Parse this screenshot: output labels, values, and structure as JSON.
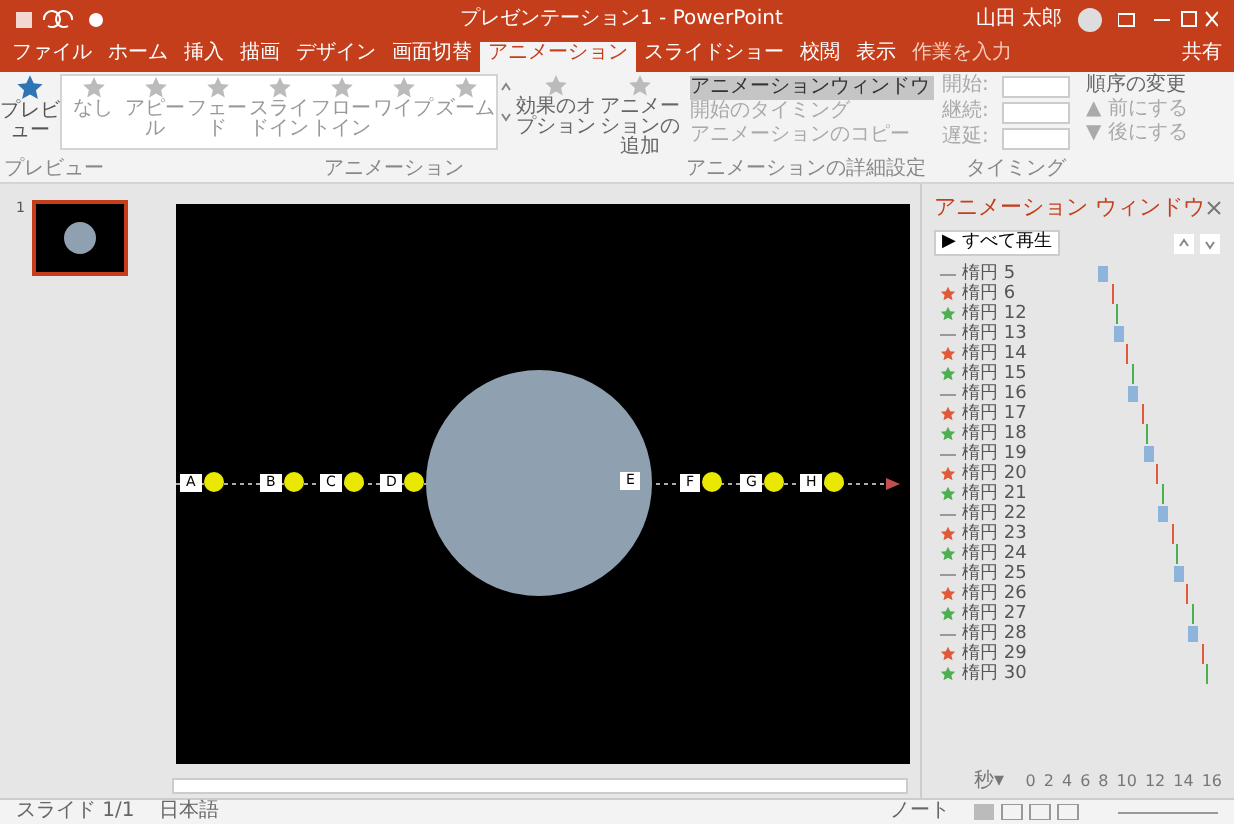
{
  "title_bar": {
    "title": "プレゼンテーション1 - PowerPoint",
    "user": "山田 太郎"
  },
  "tabs": [
    {
      "label": "ファイル",
      "selected": false
    },
    {
      "label": "ホーム",
      "selected": false
    },
    {
      "label": "挿入",
      "selected": false
    },
    {
      "label": "描画",
      "selected": false
    },
    {
      "label": "デザイン",
      "selected": false
    },
    {
      "label": "画面切替",
      "selected": false
    },
    {
      "label": "アニメーション",
      "selected": true
    },
    {
      "label": "スライドショー",
      "selected": false
    },
    {
      "label": "校閲",
      "selected": false
    },
    {
      "label": "表示",
      "selected": false
    }
  ],
  "search": {
    "placeholder": "作業を入力"
  },
  "share": "共有",
  "ribbon": {
    "preview": "プレビュー",
    "gallery": [
      {
        "label": "なし"
      },
      {
        "label": "アピール"
      },
      {
        "label": "フェード"
      },
      {
        "label": "スライドイン"
      },
      {
        "label": "フロートイン"
      },
      {
        "label": "ワイプ"
      },
      {
        "label": "ズーム"
      }
    ],
    "effect_options": "効果のオプション",
    "add_animation": "アニメーションの追加",
    "advanced": [
      {
        "label": "アニメーションウィンドウ",
        "selected": true
      },
      {
        "label": "開始のタイミング",
        "selected": false
      },
      {
        "label": "アニメーションのコピー",
        "selected": false
      }
    ],
    "timing": [
      {
        "label": "開始:"
      },
      {
        "label": "継続:"
      },
      {
        "label": "遅延:"
      }
    ],
    "reorder": {
      "title": "順序の変更",
      "items": [
        "▲ 前にする",
        "▼ 後にする"
      ]
    },
    "groups": [
      "プレビュー",
      "アニメーション",
      "アニメーションの詳細設定",
      "タイミング"
    ]
  },
  "thumbnail_number": "1",
  "slide": {
    "labels": [
      "A",
      "B",
      "C",
      "D",
      "E",
      "F",
      "G",
      "H"
    ]
  },
  "pane": {
    "title": "アニメーション ウィンドウ",
    "play": "▶ すべて再生",
    "items": [
      {
        "kind": "path",
        "label": "楕円 5"
      },
      {
        "kind": "exit",
        "label": "楕円 6"
      },
      {
        "kind": "entrance",
        "label": "楕円 12"
      },
      {
        "kind": "path",
        "label": "楕円 13"
      },
      {
        "kind": "exit",
        "label": "楕円 14"
      },
      {
        "kind": "entrance",
        "label": "楕円 15"
      },
      {
        "kind": "path",
        "label": "楕円 16"
      },
      {
        "kind": "exit",
        "label": "楕円 17"
      },
      {
        "kind": "entrance",
        "label": "楕円 18"
      },
      {
        "kind": "path",
        "label": "楕円 19"
      },
      {
        "kind": "exit",
        "label": "楕円 20"
      },
      {
        "kind": "entrance",
        "label": "楕円 21"
      },
      {
        "kind": "path",
        "label": "楕円 22"
      },
      {
        "kind": "exit",
        "label": "楕円 23"
      },
      {
        "kind": "entrance",
        "label": "楕円 24"
      },
      {
        "kind": "path",
        "label": "楕円 25"
      },
      {
        "kind": "exit",
        "label": "楕円 26"
      },
      {
        "kind": "entrance",
        "label": "楕円 27"
      },
      {
        "kind": "path",
        "label": "楕円 28"
      },
      {
        "kind": "exit",
        "label": "楕円 29"
      },
      {
        "kind": "entrance",
        "label": "楕円 30"
      }
    ],
    "unit": "秒▾",
    "scale": [
      "0",
      "2",
      "4",
      "6",
      "8",
      "10",
      "12",
      "14",
      "16"
    ]
  },
  "status_bar": {
    "slide": "スライド 1/1",
    "language": "日本語",
    "notes": "ノート"
  }
}
